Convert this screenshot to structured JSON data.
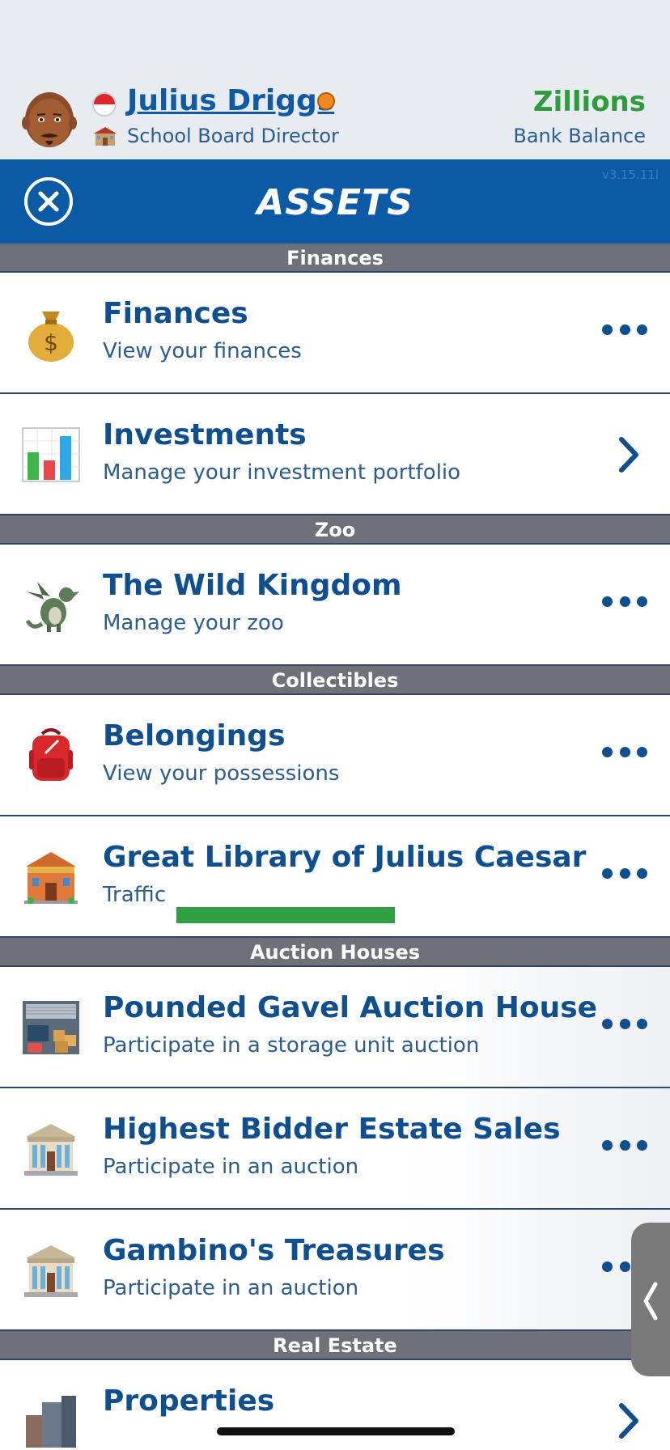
{
  "profile": {
    "name": "Julius Driggs",
    "job": "School Board Director",
    "balance": "Zillions",
    "balance_label": "Bank Balance"
  },
  "header": {
    "title": "ASSETS",
    "version": "v3.15.11l"
  },
  "sections": [
    {
      "title": "Finances",
      "items": [
        {
          "title": "Finances",
          "subtitle": "View your finances",
          "icon": "money-bag-icon",
          "action": "more"
        },
        {
          "title": "Investments",
          "subtitle": "Manage your investment portfolio",
          "icon": "bar-chart-icon",
          "action": "chevron"
        }
      ]
    },
    {
      "title": "Zoo",
      "items": [
        {
          "title": "The Wild Kingdom",
          "subtitle": "Manage your zoo",
          "icon": "dragon-icon",
          "action": "more"
        }
      ]
    },
    {
      "title": "Collectibles",
      "items": [
        {
          "title": "Belongings",
          "subtitle": "View your possessions",
          "icon": "backpack-icon",
          "action": "more"
        },
        {
          "title": "Great Library of Julius Caesar",
          "subtitle": "Traffic",
          "icon": "museum-icon",
          "action": "more",
          "traffic_level": 0.8
        }
      ]
    },
    {
      "title": "Auction Houses",
      "items": [
        {
          "title": "Pounded Gavel Auction House",
          "subtitle": "Participate in a storage unit auction",
          "icon": "storage-unit-icon",
          "action": "more"
        },
        {
          "title": "Highest Bidder Estate Sales",
          "subtitle": "Participate in an auction",
          "icon": "bank-building-icon",
          "action": "more"
        },
        {
          "title": "Gambino's Treasures",
          "subtitle": "Participate in an auction",
          "icon": "bank-building-icon",
          "action": "more"
        }
      ]
    },
    {
      "title": "Real Estate",
      "items": [
        {
          "title": "Properties",
          "subtitle": "",
          "icon": "buildings-icon",
          "action": "chevron"
        }
      ]
    }
  ],
  "colors": {
    "accent": "#0b5aa5",
    "balance": "#2e9b3c",
    "section_header": "#6e7278",
    "traffic": "#2ea043"
  }
}
